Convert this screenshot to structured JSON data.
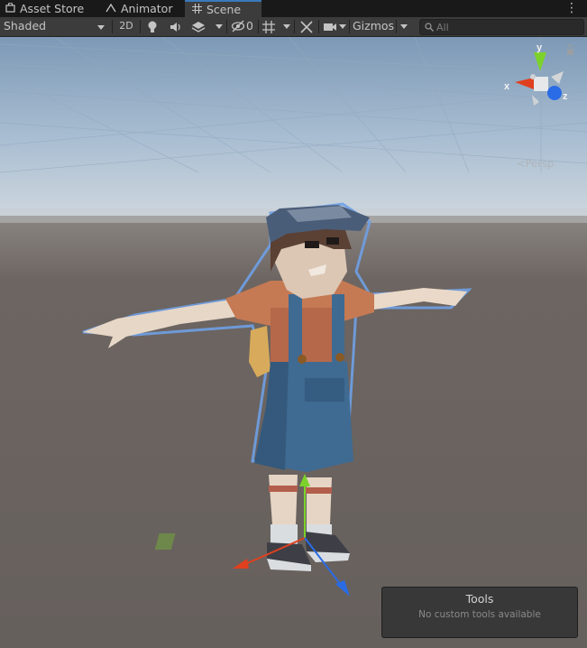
{
  "tabs": [
    {
      "label": "Asset Store",
      "icon": "shopping-bag-icon"
    },
    {
      "label": "Animator",
      "icon": "animator-icon"
    },
    {
      "label": "Scene",
      "icon": "grid-icon",
      "active": true
    }
  ],
  "toolbar": {
    "shading_mode": "Shaded",
    "toggle_2d": "2D",
    "hidden_count": "0",
    "gizmos_label": "Gizmos",
    "search_placeholder": "All"
  },
  "gizmo": {
    "axis_x": "x",
    "axis_y": "y",
    "axis_z": "z",
    "projection": "Persp"
  },
  "tools_overlay": {
    "title": "Tools",
    "subtitle": "No custom tools available"
  },
  "colors": {
    "accent": "#3a79bb",
    "axis_x": "#e0401f",
    "axis_y": "#7cd22a",
    "axis_z": "#2a6be6",
    "sky": "#9fb7d0",
    "ground": "#6b6460"
  }
}
